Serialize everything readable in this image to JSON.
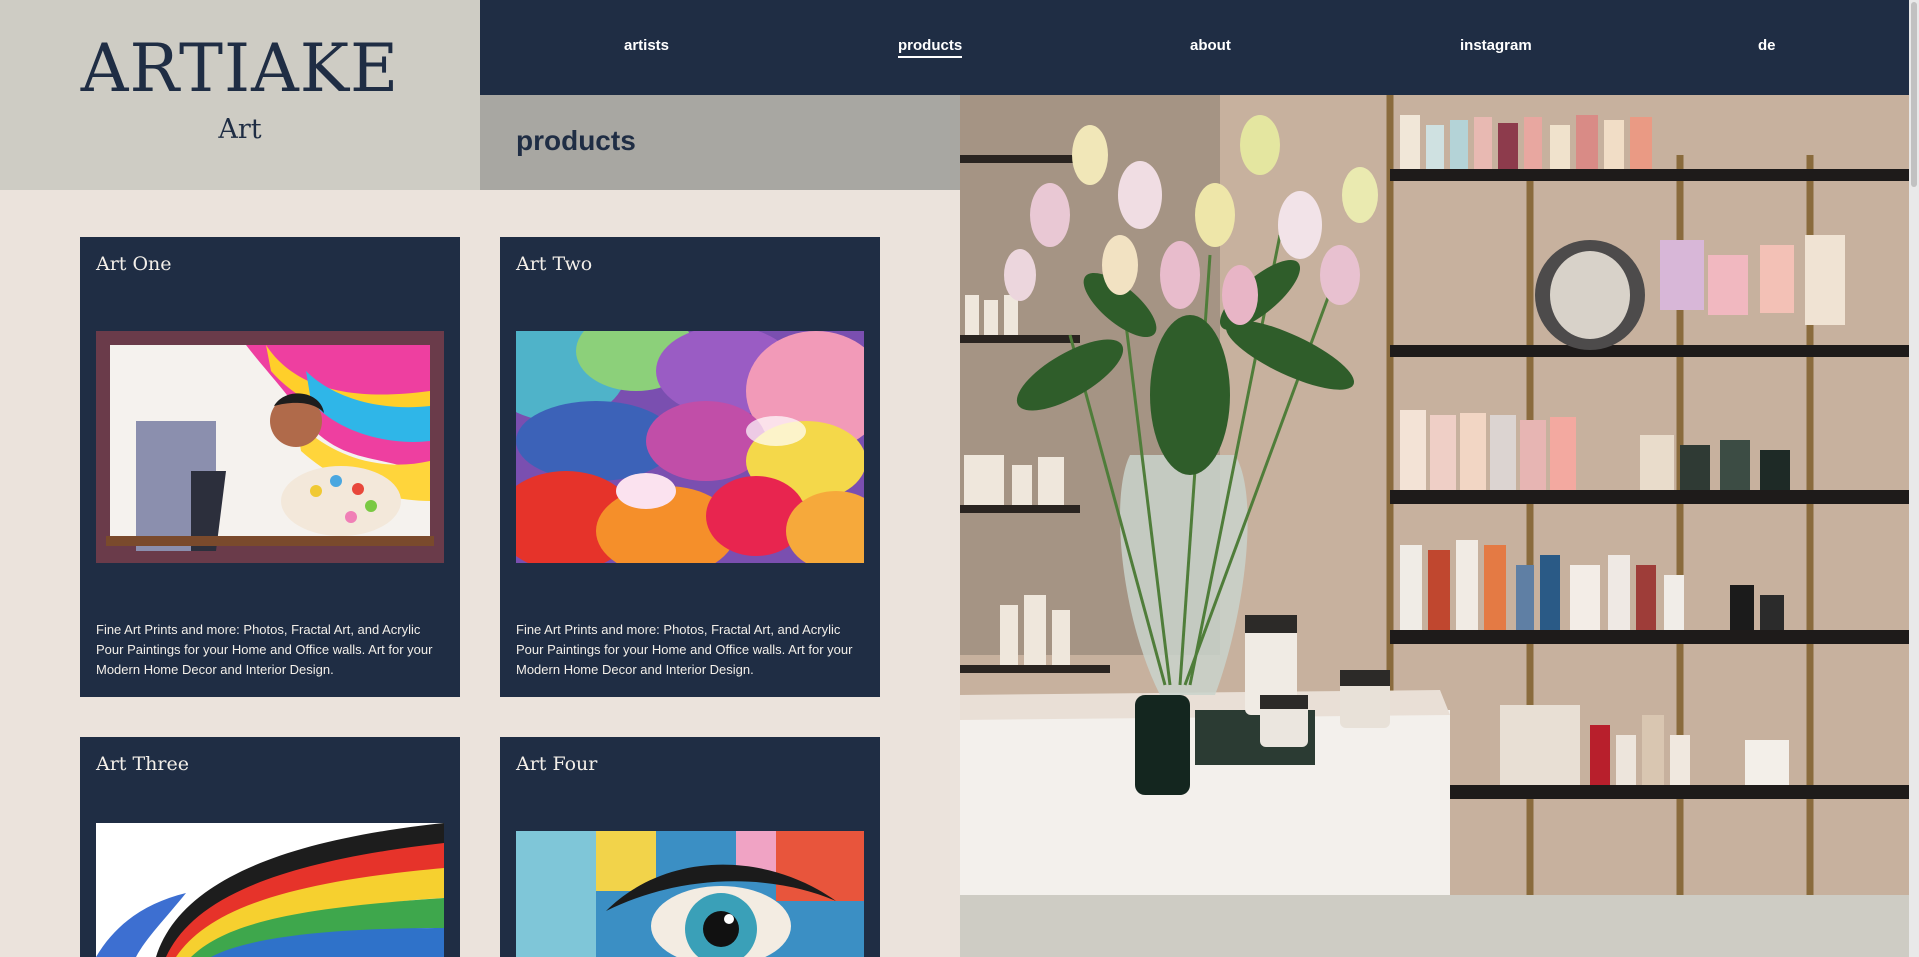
{
  "brand": {
    "name": "ARTIAKE",
    "sub": "Art"
  },
  "nav": {
    "items": [
      {
        "label": "artists"
      },
      {
        "label": "products"
      },
      {
        "label": "about"
      },
      {
        "label": "instagram"
      },
      {
        "label": "de"
      }
    ],
    "active": "products"
  },
  "page": {
    "title": "products"
  },
  "cards": [
    {
      "title": "Art One",
      "image": "painter-with-palette illustration",
      "description": "Fine Art Prints and more: Photos, Fractal Art, and Acrylic Pour Paintings for your Home and Office walls. Art for your Modern Home Decor and Interior Design."
    },
    {
      "title": "Art Two",
      "image": "colorful acrylic pour painting",
      "description": "Fine Art Prints and more: Photos, Fractal Art, and Acrylic Pour Paintings for your Home and Office walls. Art for your Modern Home Decor and Interior Design."
    },
    {
      "title": "Art Three",
      "image": "rainbow hair profile painting"
    },
    {
      "title": "Art Four",
      "image": "colorful eye close-up painting"
    }
  ],
  "hero": {
    "image": "store interior with lilies vase and product shelves"
  },
  "colors": {
    "navy": "#1f2d44",
    "sand": "#ebe3dc",
    "stone": "#ceccc4",
    "grey": "#a8a7a2"
  }
}
